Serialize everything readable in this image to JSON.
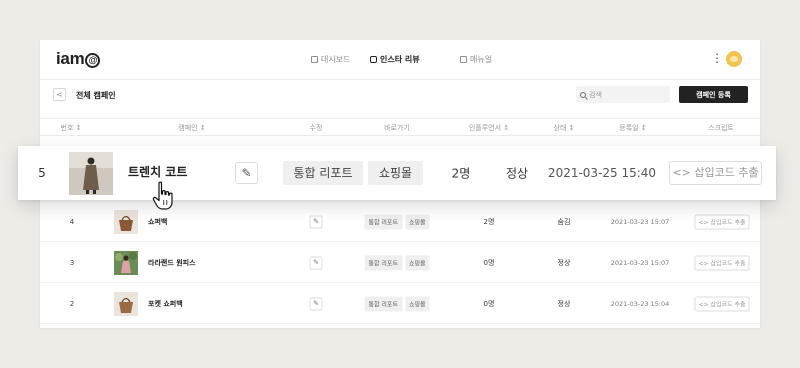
{
  "nav": {
    "logo": "iam",
    "logo_at": "@",
    "items": [
      {
        "label": "대시보드",
        "icon": "home-icon",
        "active": false
      },
      {
        "label": "인스타 리뷰",
        "icon": "instagram-icon",
        "active": true
      },
      {
        "label": "매뉴얼",
        "icon": "book-icon",
        "active": false
      }
    ],
    "more_icon": "⋮"
  },
  "toolbar": {
    "back_label": "<",
    "title": "전체 캠페인",
    "search_placeholder": "검색",
    "register_label": "캠페인 등록"
  },
  "table": {
    "columns": [
      "번호 ↕",
      "캠페인 ↕",
      "수정",
      "바로가기",
      "인플루언서 ↕",
      "상태 ↕",
      "등록일 ↕",
      "스크립트"
    ],
    "highlighted_row": {
      "num": "5",
      "name": "트렌치 코트",
      "edit_icon": "✎",
      "tag_report": "통합 리포트",
      "tag_shop": "쇼핑몰",
      "influencers": "2명",
      "status": "정상",
      "date": "2021-03-25 15:40",
      "code": "<> 삽입코드 추출"
    },
    "rows": [
      {
        "num": "4",
        "name": "쇼퍼백",
        "edit_icon": "✎",
        "tag_report": "통합 리포트",
        "tag_shop": "쇼핑몰",
        "influencers": "2명",
        "status": "숨김",
        "date": "2021-03-23 15:07",
        "code": "<> 삽입코드 추출"
      },
      {
        "num": "3",
        "name": "라라랜드 원피스",
        "edit_icon": "✎",
        "tag_report": "통합 리포트",
        "tag_shop": "쇼핑몰",
        "influencers": "0명",
        "status": "정상",
        "date": "2021-03-23 15:07",
        "code": "<> 삽입코드 추출"
      },
      {
        "num": "2",
        "name": "포켓 쇼퍼백",
        "edit_icon": "✎",
        "tag_report": "통합 리포트",
        "tag_shop": "쇼핑몰",
        "influencers": "0명",
        "status": "정상",
        "date": "2021-03-23 15:04",
        "code": "<> 삽입코드 추출"
      }
    ]
  },
  "colors": {
    "background": "#eeece7",
    "primary_button": "#222222",
    "tag_bg": "#efefef"
  }
}
